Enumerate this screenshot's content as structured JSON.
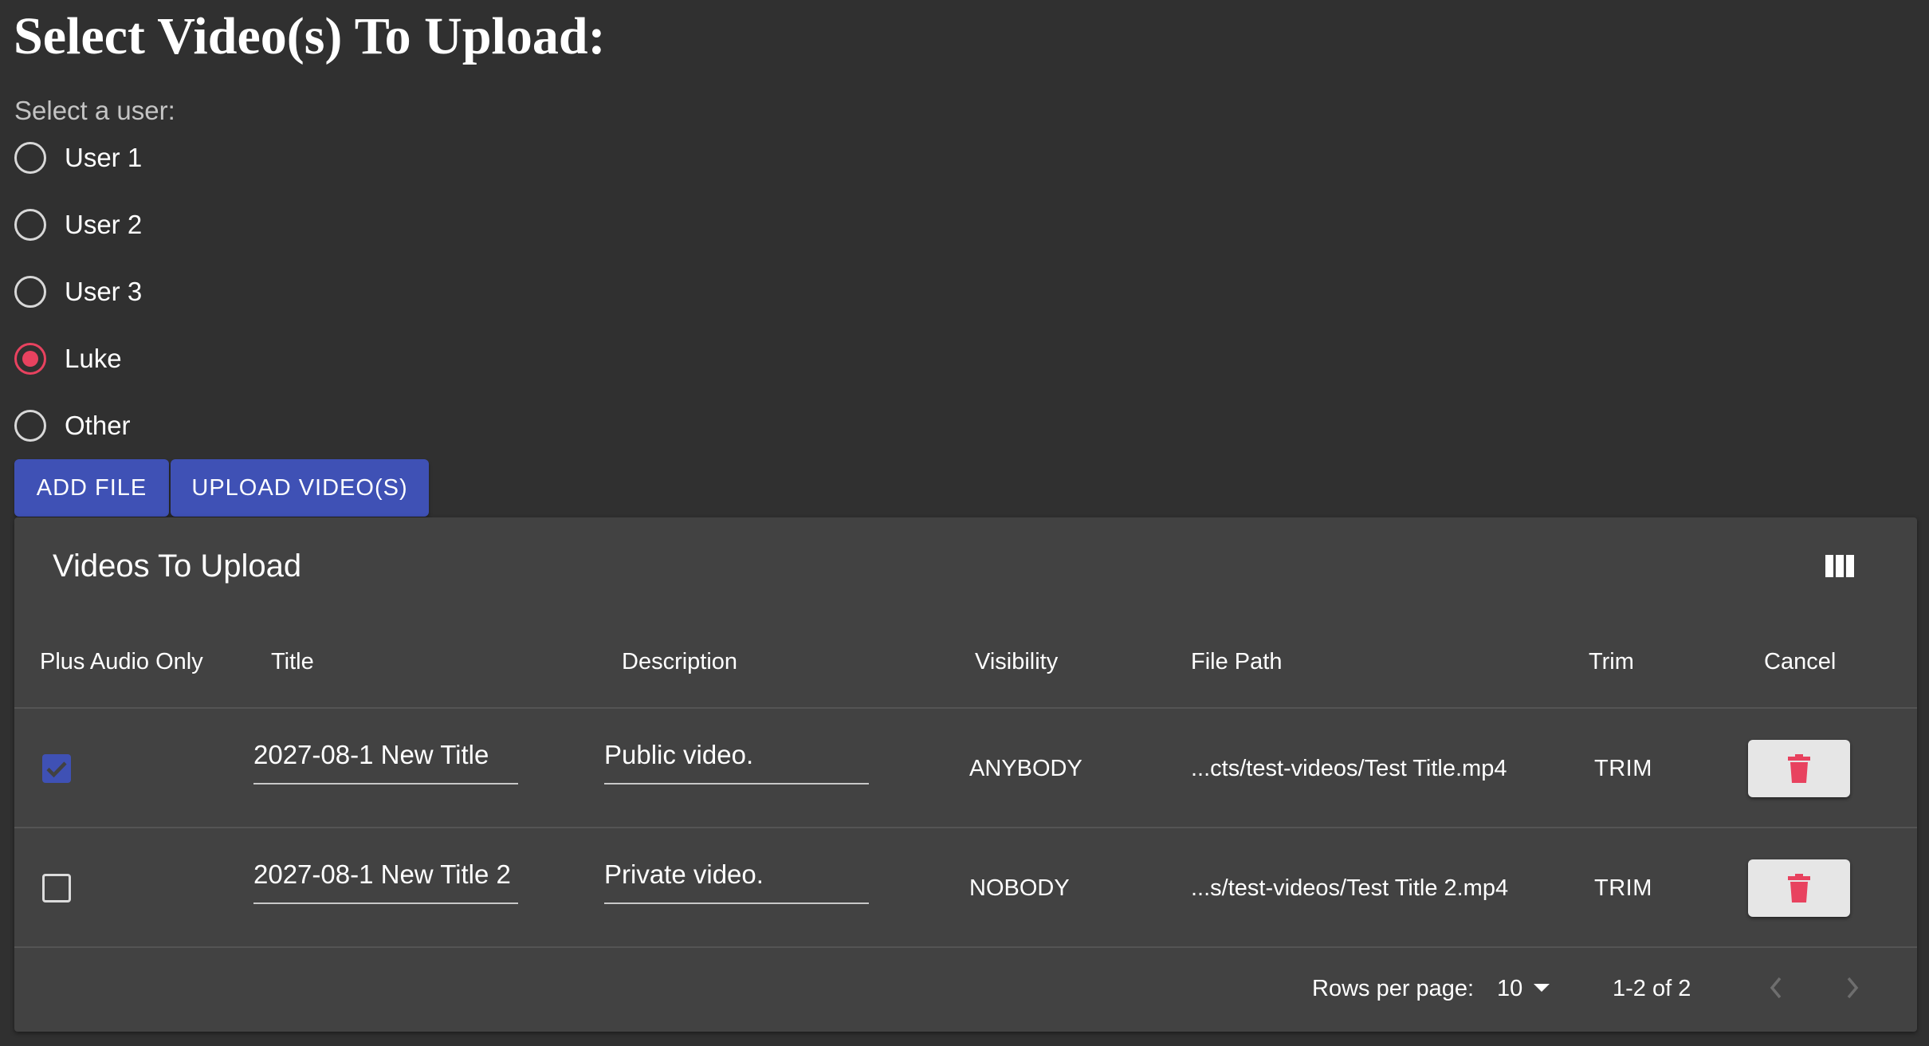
{
  "page": {
    "title": "Select Video(s) To Upload:",
    "user_label": "Select a user:"
  },
  "users": [
    {
      "label": "User 1",
      "checked": false
    },
    {
      "label": "User 2",
      "checked": false
    },
    {
      "label": "User 3",
      "checked": false
    },
    {
      "label": "Luke",
      "checked": true
    },
    {
      "label": "Other",
      "checked": false
    }
  ],
  "buttons": {
    "add_file": "ADD FILE",
    "upload_videos": "UPLOAD VIDEO(S)"
  },
  "table": {
    "title": "Videos To Upload",
    "columns_icon": "view-column-icon",
    "headers": {
      "plus_audio_only": "Plus Audio Only",
      "title": "Title",
      "description": "Description",
      "visibility": "Visibility",
      "file_path": "File Path",
      "trim": "Trim",
      "cancel": "Cancel"
    },
    "rows": [
      {
        "plus_audio_only": true,
        "title": "2027-08-1 New Title",
        "description": "Public video.",
        "visibility": "ANYBODY",
        "file_path": "...cts/test-videos/Test Title.mp4",
        "trim": "TRIM",
        "cancel_icon": "trash-icon"
      },
      {
        "plus_audio_only": false,
        "title": "2027-08-1 New Title 2",
        "description": "Private video.",
        "visibility": "NOBODY",
        "file_path": "...s/test-videos/Test Title 2.mp4",
        "trim": "TRIM",
        "cancel_icon": "trash-icon"
      }
    ],
    "pagination": {
      "rows_per_page_label": "Rows per page:",
      "rows_per_page_value": "10",
      "range_text": "1-2 of 2"
    }
  },
  "colors": {
    "background": "#303030",
    "card": "#424242",
    "primary": "#3f51b5",
    "accent": "#e8425f",
    "cancel_button_bg": "#e6e6e6"
  }
}
